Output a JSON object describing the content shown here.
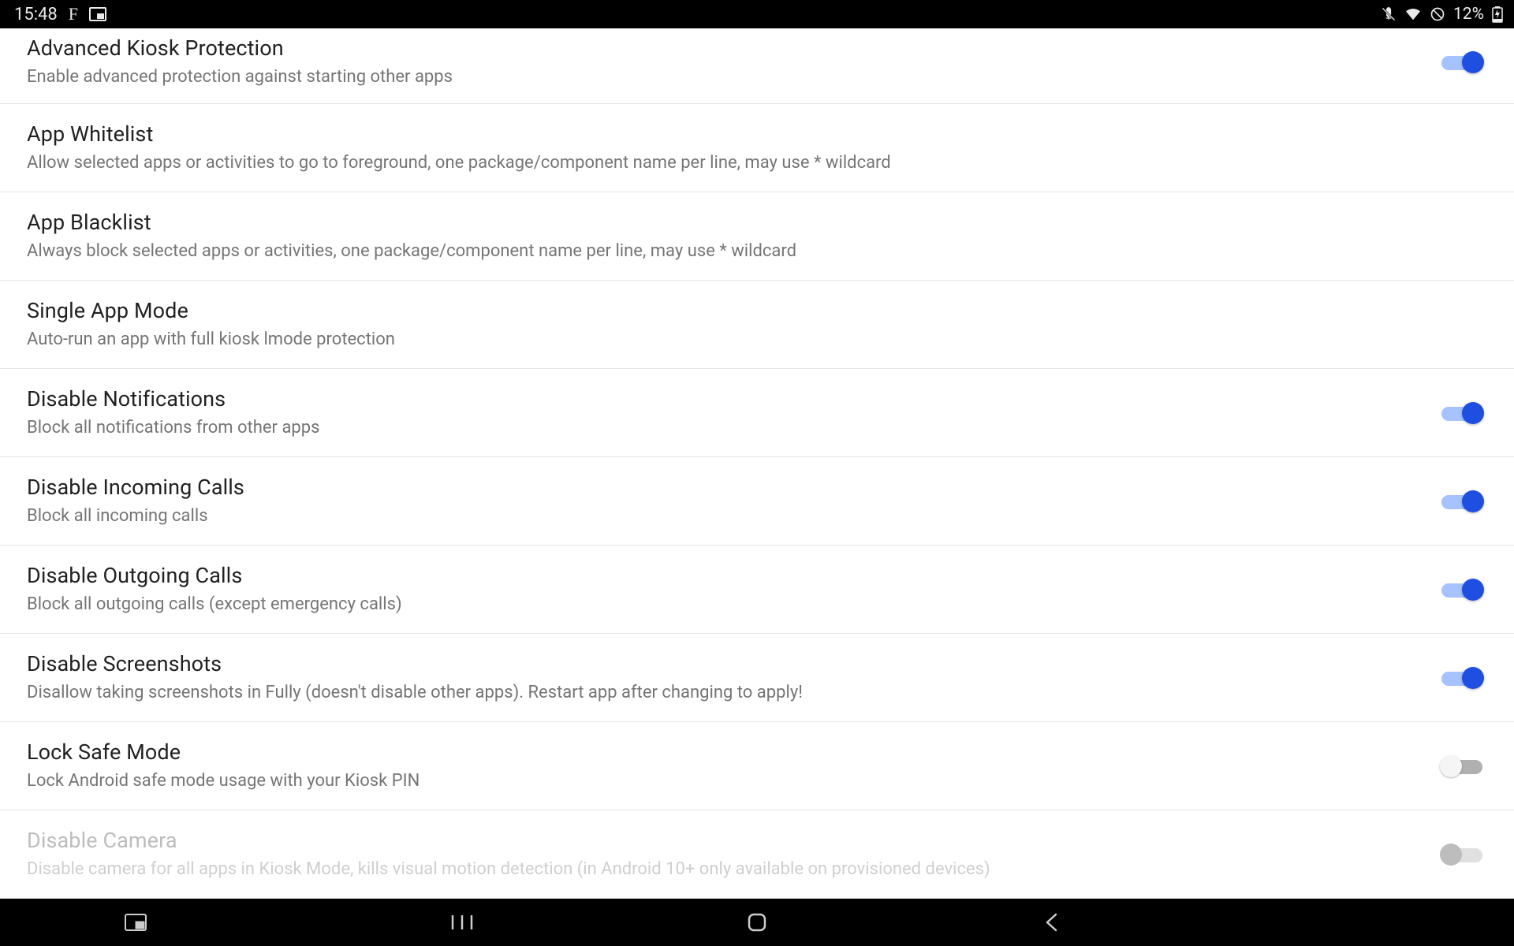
{
  "statusbar": {
    "clock": "15:48",
    "app_letter": "F",
    "battery_text": "12%"
  },
  "settings": [
    {
      "key": "advanced-kiosk-protection",
      "title": "Advanced Kiosk Protection",
      "subtitle": "Enable advanced protection against starting other apps",
      "has_switch": true,
      "switch_on": true,
      "disabled": false
    },
    {
      "key": "app-whitelist",
      "title": "App Whitelist",
      "subtitle": "Allow selected apps or activities to go to foreground, one package/component name per line, may use * wildcard",
      "has_switch": false,
      "disabled": false
    },
    {
      "key": "app-blacklist",
      "title": "App Blacklist",
      "subtitle": "Always block selected apps or activities, one package/component name per line, may use * wildcard",
      "has_switch": false,
      "disabled": false
    },
    {
      "key": "single-app-mode",
      "title": "Single App Mode",
      "subtitle": "Auto-run an app with full kiosk lmode protection",
      "has_switch": false,
      "disabled": false
    },
    {
      "key": "disable-notifications",
      "title": "Disable Notifications",
      "subtitle": "Block all notifications from other apps",
      "has_switch": true,
      "switch_on": true,
      "disabled": false
    },
    {
      "key": "disable-incoming-calls",
      "title": "Disable Incoming Calls",
      "subtitle": "Block all incoming calls",
      "has_switch": true,
      "switch_on": true,
      "disabled": false
    },
    {
      "key": "disable-outgoing-calls",
      "title": "Disable Outgoing Calls",
      "subtitle": "Block all outgoing calls (except emergency calls)",
      "has_switch": true,
      "switch_on": true,
      "disabled": false
    },
    {
      "key": "disable-screenshots",
      "title": "Disable Screenshots",
      "subtitle": "Disallow taking screenshots in Fully (doesn't disable other apps). Restart app after changing to apply!",
      "has_switch": true,
      "switch_on": true,
      "disabled": false
    },
    {
      "key": "lock-safe-mode",
      "title": "Lock Safe Mode",
      "subtitle": "Lock Android safe mode usage with your Kiosk PIN",
      "has_switch": true,
      "switch_on": false,
      "disabled": false
    },
    {
      "key": "disable-camera",
      "title": "Disable Camera",
      "subtitle": "Disable camera for all apps in Kiosk Mode, kills visual motion detection (in Android 10+ only available on provisioned devices)",
      "has_switch": true,
      "switch_on": false,
      "disabled": true
    }
  ]
}
